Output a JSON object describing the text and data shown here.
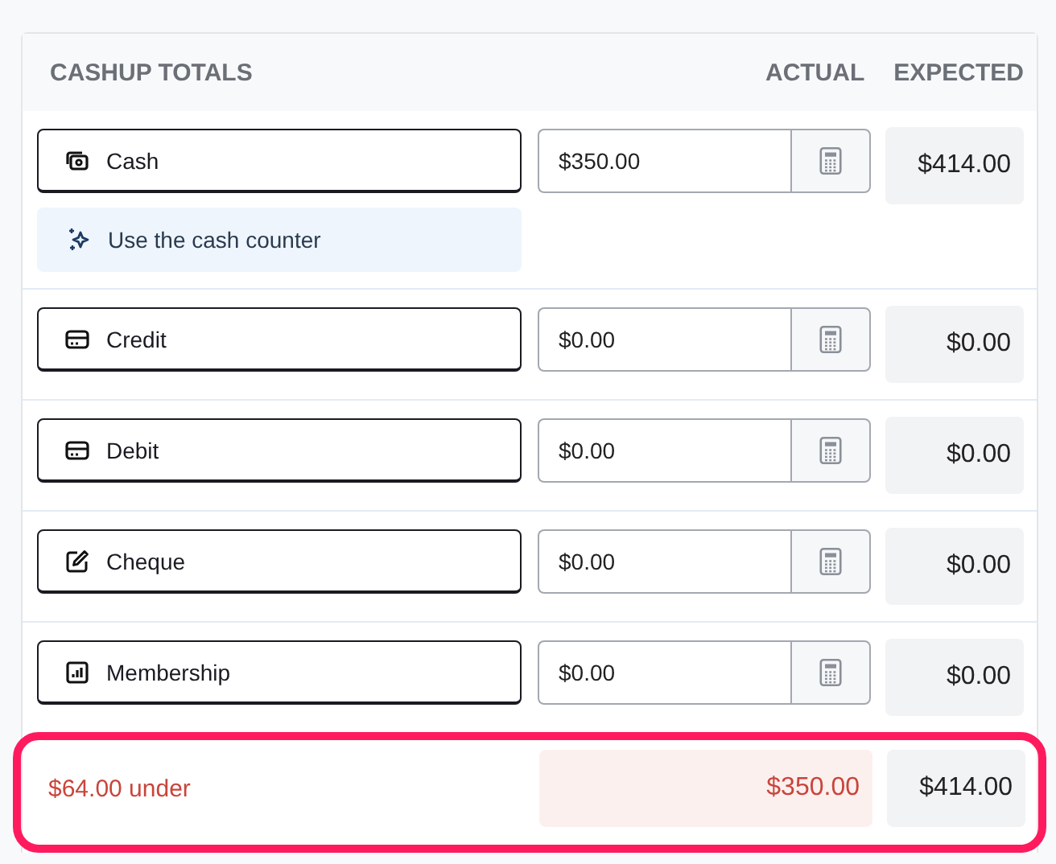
{
  "header": {
    "title": "CASHUP TOTALS",
    "actual": "ACTUAL",
    "expected": "EXPECTED"
  },
  "rows": [
    {
      "kind": "cash",
      "label": "Cash",
      "value": "$350.00",
      "expected": "$414.00",
      "helper": "Use the cash counter"
    },
    {
      "kind": "card",
      "label": "Credit",
      "value": "$0.00",
      "expected": "$0.00"
    },
    {
      "kind": "card",
      "label": "Debit",
      "value": "$0.00",
      "expected": "$0.00"
    },
    {
      "kind": "cheque",
      "label": "Cheque",
      "value": "$0.00",
      "expected": "$0.00"
    },
    {
      "kind": "chart",
      "label": "Membership",
      "value": "$0.00",
      "expected": "$0.00"
    }
  ],
  "footer": {
    "difference": "$64.00 under",
    "actual": "$350.00",
    "expected": "$414.00",
    "highlighted": true
  }
}
